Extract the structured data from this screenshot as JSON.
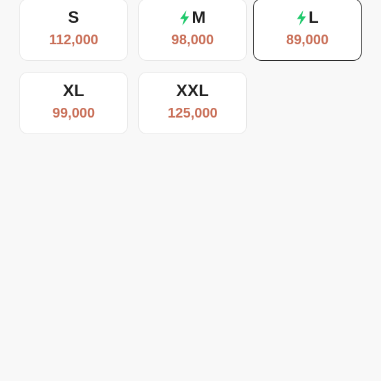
{
  "colors": {
    "background": "#f8f8f8",
    "card_background": "#ffffff",
    "card_border": "#e7e7e7",
    "selected_border": "#2b2b2b",
    "price": "#c96f58",
    "size_text": "#222222",
    "bolt": "#1fc96b"
  },
  "sizes": [
    {
      "label": "S",
      "price": "112,000",
      "fast_delivery": false,
      "selected": false
    },
    {
      "label": "M",
      "price": "98,000",
      "fast_delivery": true,
      "selected": false
    },
    {
      "label": "L",
      "price": "89,000",
      "fast_delivery": true,
      "selected": true
    },
    {
      "label": "XL",
      "price": "99,000",
      "fast_delivery": false,
      "selected": false
    },
    {
      "label": "XXL",
      "price": "125,000",
      "fast_delivery": false,
      "selected": false
    }
  ],
  "icons": {
    "fast_delivery": "lightning-bolt-icon"
  }
}
